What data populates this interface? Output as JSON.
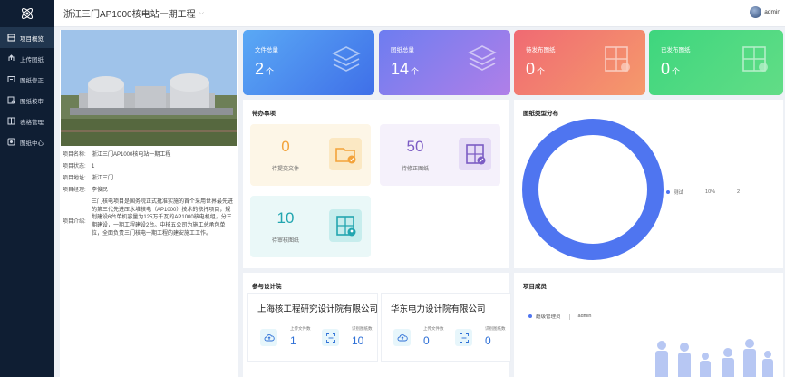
{
  "header": {
    "project_title": "浙江三门AP1000核电站一期工程",
    "user_name": "admin"
  },
  "sidebar": {
    "items": [
      {
        "label": "项目概览",
        "icon": "dashboard-icon",
        "active": true
      },
      {
        "label": "上传图纸",
        "icon": "upload-icon",
        "active": false
      },
      {
        "label": "图纸修正",
        "icon": "edit-drawing-icon",
        "active": false
      },
      {
        "label": "图纸校审",
        "icon": "review-icon",
        "active": false
      },
      {
        "label": "表格管理",
        "icon": "table-icon",
        "active": false
      },
      {
        "label": "图纸中心",
        "icon": "drawing-center-icon",
        "active": false
      }
    ]
  },
  "project_info": {
    "rows": [
      {
        "key": "项目名称:",
        "value": "浙江三门AP1000核电站一期工程"
      },
      {
        "key": "项目状态:",
        "value": "1"
      },
      {
        "key": "项目地址:",
        "value": "浙江三门"
      },
      {
        "key": "项目经理:",
        "value": "李俊民"
      }
    ],
    "desc_key": "项目介绍:",
    "desc_value": "三门核电项目是国务院正式批准实施的首个采用世界最先进的第三代先进压水堆核电（AP1000）技术的依托项目，规划建设6台单机容量为125万千瓦的AP1000核电机组，分三期建设，一期工程建设2台。中核五公司为施工总承包单位，全面负责三门核电一期工程的建安施工工作。"
  },
  "stat_cards": [
    {
      "label": "文件总量",
      "value": "2",
      "unit": "个",
      "color_from": "#5aa9f5",
      "color_to": "#3f6fe8",
      "icon": "layers-icon"
    },
    {
      "label": "图纸总量",
      "value": "14",
      "unit": "个",
      "color_from": "#6d7df0",
      "color_to": "#b07fe8",
      "icon": "stack-icon"
    },
    {
      "label": "待发布图纸",
      "value": "0",
      "unit": "个",
      "color_from": "#f06a73",
      "color_to": "#f59a6b",
      "icon": "pending-drawing-icon"
    },
    {
      "label": "已发布图纸",
      "value": "0",
      "unit": "个",
      "color_from": "#3ed67e",
      "color_to": "#62dd86",
      "icon": "published-drawing-icon"
    }
  ],
  "todo": {
    "title": "待办事项",
    "items": [
      {
        "value": "0",
        "label": "待提交文件",
        "color": "#f3a33b",
        "bg": "#fdf6e7",
        "icon_bg": "#fbe8c3",
        "icon": "folder-check-icon"
      },
      {
        "value": "50",
        "label": "待修正图纸",
        "color": "#7c5cc4",
        "bg": "#f5f1fb",
        "icon_bg": "#e6dcf6",
        "icon": "drawing-edit-icon"
      },
      {
        "value": "10",
        "label": "待审核图纸",
        "color": "#23a6b0",
        "bg": "#eaf8f8",
        "icon_bg": "#c7eded",
        "icon": "drawing-review-icon"
      }
    ]
  },
  "distribution": {
    "title": "图纸类型分布",
    "legend": [
      {
        "name": "测试",
        "percent": "10%",
        "count": "2",
        "color": "#4f75f0"
      }
    ]
  },
  "design_orgs": {
    "title": "参与设计院",
    "items": [
      {
        "name": "上海核工程研究设计院有限公司",
        "upload_label": "上传文件数",
        "upload_value": "1",
        "recognize_label": "识别图纸数",
        "recognize_value": "10"
      },
      {
        "name": "华东电力设计院有限公司",
        "upload_label": "上传文件数",
        "upload_value": "0",
        "recognize_label": "识别图纸数",
        "recognize_value": "0"
      }
    ]
  },
  "members": {
    "title": "项目成员",
    "items": [
      {
        "role": "超级管理员",
        "name": "admin"
      }
    ]
  },
  "chart_data": {
    "type": "pie",
    "title": "图纸类型分布",
    "categories": [
      "测试"
    ],
    "values": [
      2
    ],
    "percent": [
      "10%"
    ]
  }
}
